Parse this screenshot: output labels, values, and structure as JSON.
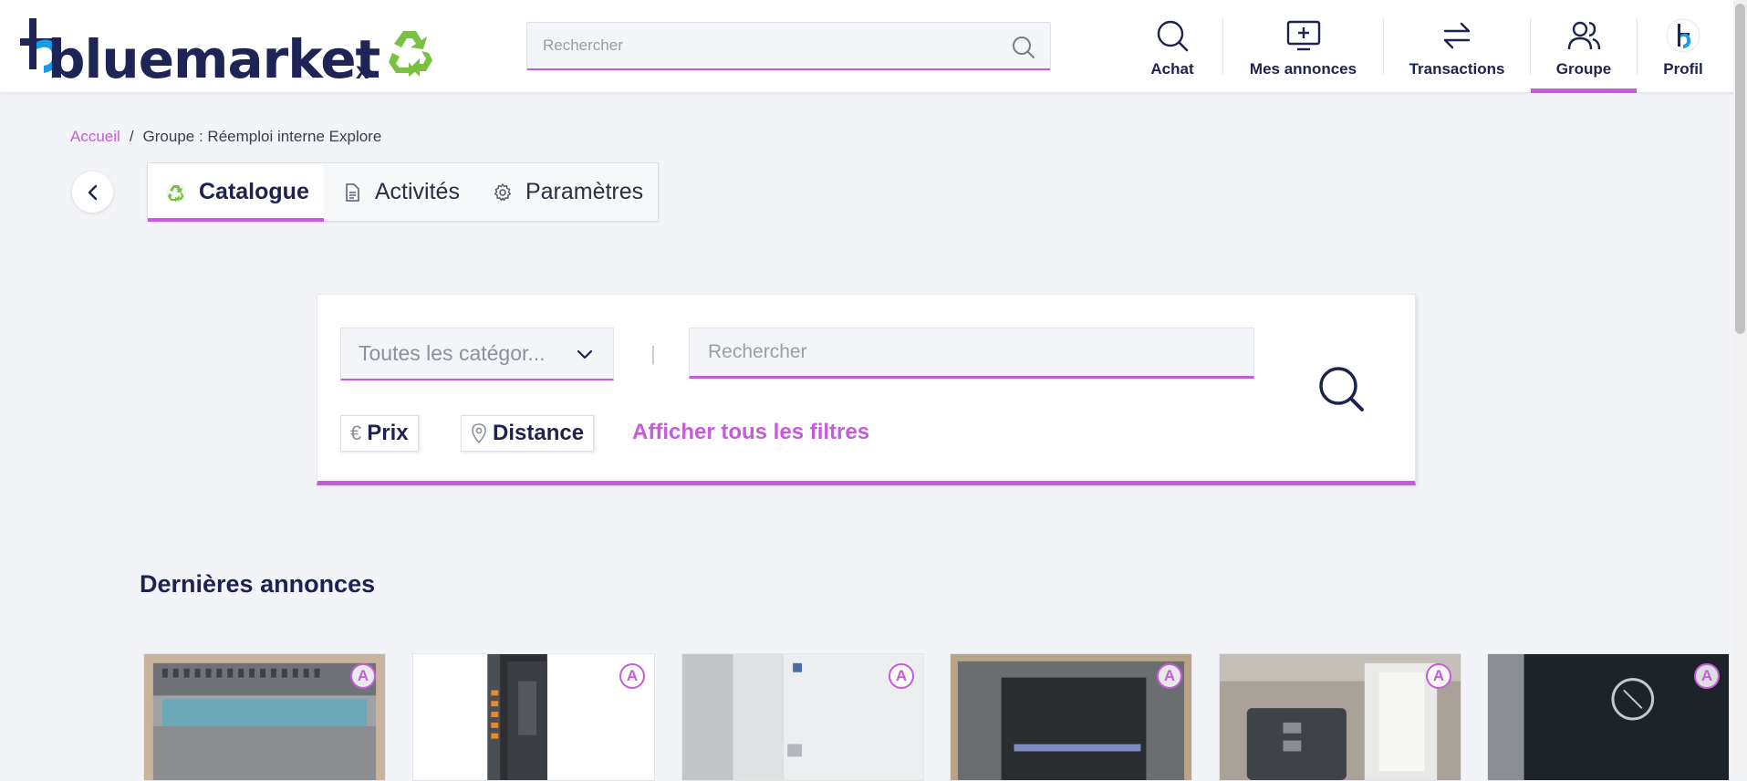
{
  "header": {
    "brand": "bluemarket",
    "brand_suffix": "x",
    "search_placeholder": "Rechercher",
    "nav": [
      {
        "label": "Achat",
        "icon": "search-icon"
      },
      {
        "label": "Mes annonces",
        "icon": "add-listing-icon"
      },
      {
        "label": "Transactions",
        "icon": "swap-arrows-icon"
      },
      {
        "label": "Groupe",
        "icon": "users-icon",
        "active": true
      },
      {
        "label": "Profil",
        "icon": "avatar-logo-icon"
      }
    ]
  },
  "breadcrumb": {
    "home": "Accueil",
    "separator": "/",
    "current": "Groupe : Réemploi interne Explore"
  },
  "tabs": [
    {
      "label": "Catalogue",
      "icon": "recycle-icon",
      "active": true
    },
    {
      "label": "Activités",
      "icon": "document-icon"
    },
    {
      "label": "Paramètres",
      "icon": "gear-icon"
    }
  ],
  "search_card": {
    "category_select": "Toutes les catégor...",
    "separator": "|",
    "search_placeholder": "Rechercher",
    "chips": [
      {
        "label": "Prix",
        "icon": "€"
      },
      {
        "label": "Distance",
        "icon": "location-pin-icon"
      }
    ],
    "all_filters": "Afficher tous les filtres"
  },
  "latest": {
    "title": "Dernières annonces",
    "badge_letter": "A",
    "ads": [
      {
        "name": "ad-1",
        "image": "industrial-io-module"
      },
      {
        "name": "ad-2",
        "image": "siemens-sinamics-drive"
      },
      {
        "name": "ad-3",
        "image": "schneider-electric-module"
      },
      {
        "name": "ad-4",
        "image": "hmi-touch-panel"
      },
      {
        "name": "ad-5",
        "image": "profibus-adapter"
      },
      {
        "name": "ad-6",
        "image": "fuse-1a"
      }
    ]
  },
  "colors": {
    "accent": "#c65bdb",
    "navy": "#1d2251",
    "brand_blue": "#1a9be6",
    "recycle_green": "#7ac142",
    "background": "#f2f4f7"
  }
}
